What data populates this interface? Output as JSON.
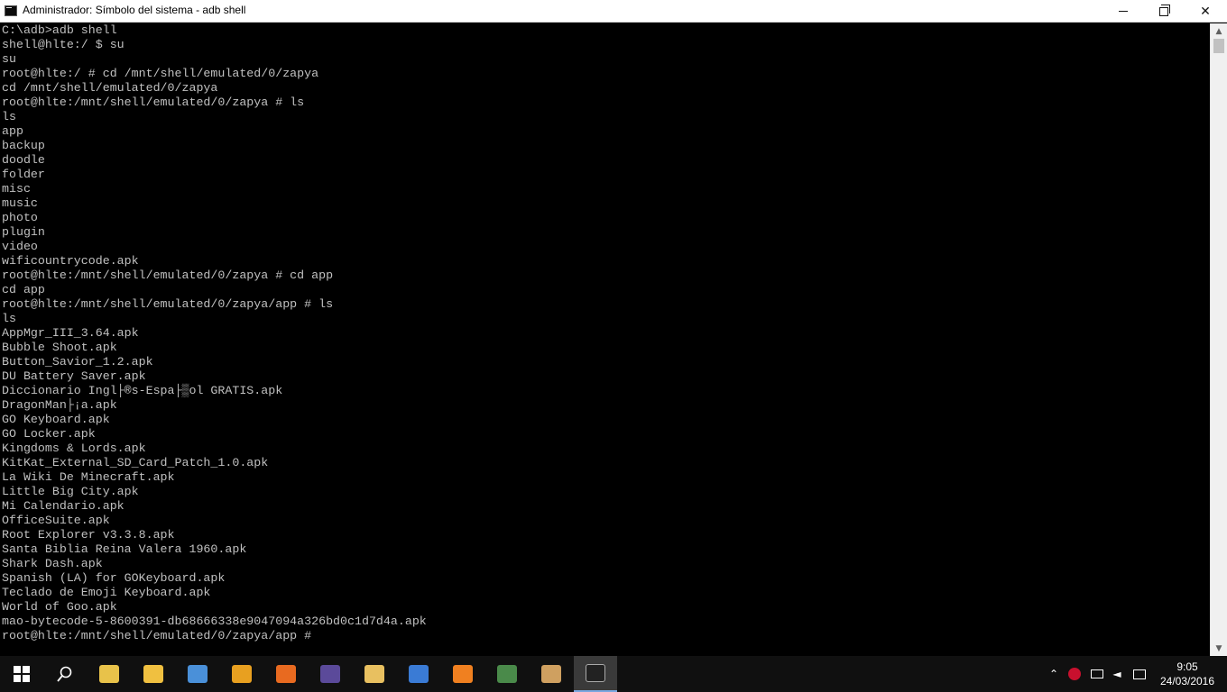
{
  "window": {
    "title": "Administrador: Símbolo del sistema - adb  shell"
  },
  "console": {
    "lines": [
      "C:\\adb>adb shell",
      "shell@hlte:/ $ su",
      "su",
      "root@hlte:/ # cd /mnt/shell/emulated/0/zapya",
      "cd /mnt/shell/emulated/0/zapya",
      "root@hlte:/mnt/shell/emulated/0/zapya # ls",
      "ls",
      "app",
      "backup",
      "doodle",
      "folder",
      "misc",
      "music",
      "photo",
      "plugin",
      "video",
      "wificountrycode.apk",
      "root@hlte:/mnt/shell/emulated/0/zapya # cd app",
      "cd app",
      "root@hlte:/mnt/shell/emulated/0/zapya/app # ls",
      "ls",
      "AppMgr_III_3.64.apk",
      "Bubble Shoot.apk",
      "Button_Savior_1.2.apk",
      "DU Battery Saver.apk",
      "Diccionario Ingl├®s-Espa├▒ol GRATIS.apk",
      "DragonMan├¡a.apk",
      "GO Keyboard.apk",
      "GO Locker.apk",
      "Kingdoms & Lords.apk",
      "KitKat_External_SD_Card_Patch_1.0.apk",
      "La Wiki De Minecraft.apk",
      "Little Big City.apk",
      "Mi Calendario.apk",
      "OfficeSuite.apk",
      "Root Explorer v3.3.8.apk",
      "Santa Biblia Reina Valera 1960.apk",
      "Shark Dash.apk",
      "Spanish (LA) for GOKeyboard.apk",
      "Teclado de Emoji Keyboard.apk",
      "World of Goo.apk",
      "mao-bytecode-5-8600391-db68666338e9047094a326bd0c1d7d4a.apk",
      "root@hlte:/mnt/shell/emulated/0/zapya/app #"
    ]
  },
  "taskbar": {
    "apps": [
      {
        "name": "file-explorer-icon",
        "color": "#e8c24a"
      },
      {
        "name": "folder-icon",
        "color": "#f0c040"
      },
      {
        "name": "search-app-icon",
        "color": "#4a90d9"
      },
      {
        "name": "media-player-icon",
        "color": "#e8a020"
      },
      {
        "name": "firefox-icon",
        "color": "#e86a20"
      },
      {
        "name": "eclipse-icon",
        "color": "#5b4a9a"
      },
      {
        "name": "mail-icon",
        "color": "#e8c060"
      },
      {
        "name": "network-icon",
        "color": "#3a7bd5"
      },
      {
        "name": "fire-app-icon",
        "color": "#f08020"
      },
      {
        "name": "security-app-icon",
        "color": "#4a8a4a"
      },
      {
        "name": "paint-icon",
        "color": "#cfa060"
      },
      {
        "name": "command-prompt-icon",
        "color": "#222222"
      }
    ],
    "clock": {
      "time": "9:05",
      "date": "24/03/2016"
    }
  }
}
